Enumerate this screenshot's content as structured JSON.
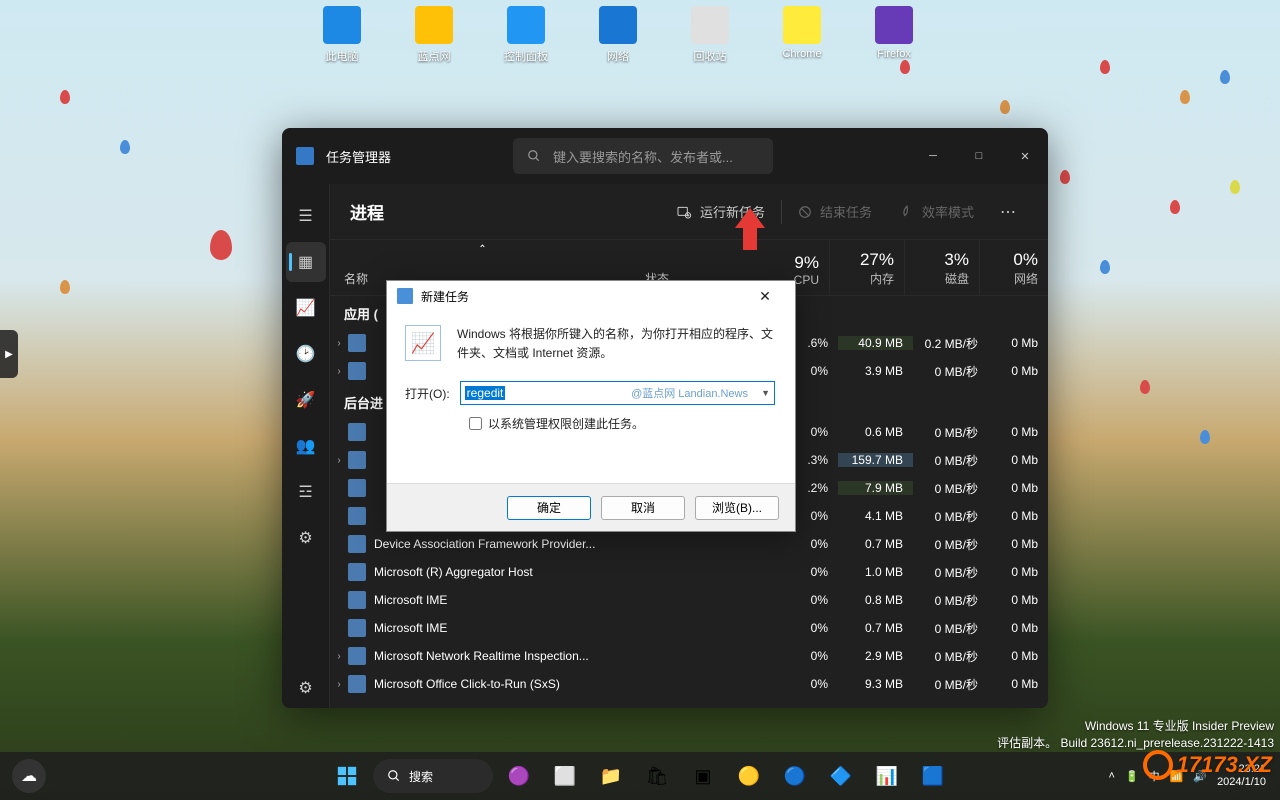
{
  "desktop": {
    "icons": [
      {
        "name": "此电脑",
        "color": "#1e88e5"
      },
      {
        "name": "蓝点网",
        "color": "#ffc107"
      },
      {
        "name": "控制面板",
        "color": "#2196f3"
      },
      {
        "name": "网络",
        "color": "#1976d2"
      },
      {
        "name": "回收站",
        "color": "#e0e0e0"
      },
      {
        "name": "Chrome",
        "color": "#ffeb3b"
      },
      {
        "name": "Firefox",
        "color": "#673ab7"
      }
    ]
  },
  "task_manager": {
    "title": "任务管理器",
    "search_placeholder": "键入要搜索的名称、发布者或...",
    "tab": "进程",
    "toolbar": {
      "run_new": "运行新任务",
      "end_task": "结束任务",
      "efficiency": "效率模式"
    },
    "columns": {
      "name": "名称",
      "status": "状态",
      "cpu": {
        "pct": "9%",
        "label": "CPU"
      },
      "mem": {
        "pct": "27%",
        "label": "内存"
      },
      "disk": {
        "pct": "3%",
        "label": "磁盘"
      },
      "net": {
        "pct": "0%",
        "label": "网络"
      }
    },
    "sections": {
      "apps": "应用 (",
      "background": "后台进"
    },
    "rows": [
      {
        "exp": "›",
        "name": "",
        "cpu": ".6%",
        "mem": "40.9 MB",
        "disk": "0.2 MB/秒",
        "net": "0 Mb",
        "h": 1
      },
      {
        "exp": "›",
        "name": "",
        "cpu": "0%",
        "mem": "3.9 MB",
        "disk": "0 MB/秒",
        "net": "0 Mb",
        "h": 0
      },
      {
        "exp": "",
        "name": "",
        "cpu": "0%",
        "mem": "0.6 MB",
        "disk": "0 MB/秒",
        "net": "0 Mb",
        "h": 0
      },
      {
        "exp": "›",
        "name": "",
        "cpu": ".3%",
        "mem": "159.7 MB",
        "disk": "0 MB/秒",
        "net": "0 Mb",
        "h": 2
      },
      {
        "exp": "",
        "name": "",
        "cpu": ".2%",
        "mem": "7.9 MB",
        "disk": "0 MB/秒",
        "net": "0 Mb",
        "h": 1
      },
      {
        "exp": "",
        "name": "",
        "cpu": "0%",
        "mem": "4.1 MB",
        "disk": "0 MB/秒",
        "net": "0 Mb",
        "h": 0
      },
      {
        "exp": "",
        "name": "Device Association Framework Provider...",
        "cpu": "0%",
        "mem": "0.7 MB",
        "disk": "0 MB/秒",
        "net": "0 Mb",
        "h": 0
      },
      {
        "exp": "",
        "name": "Microsoft (R) Aggregator Host",
        "cpu": "0%",
        "mem": "1.0 MB",
        "disk": "0 MB/秒",
        "net": "0 Mb",
        "h": 0
      },
      {
        "exp": "",
        "name": "Microsoft IME",
        "cpu": "0%",
        "mem": "0.8 MB",
        "disk": "0 MB/秒",
        "net": "0 Mb",
        "h": 0
      },
      {
        "exp": "",
        "name": "Microsoft IME",
        "cpu": "0%",
        "mem": "0.7 MB",
        "disk": "0 MB/秒",
        "net": "0 Mb",
        "h": 0
      },
      {
        "exp": "›",
        "name": "Microsoft Network Realtime Inspection...",
        "cpu": "0%",
        "mem": "2.9 MB",
        "disk": "0 MB/秒",
        "net": "0 Mb",
        "h": 0
      },
      {
        "exp": "›",
        "name": "Microsoft Office Click-to-Run (SxS)",
        "cpu": "0%",
        "mem": "9.3 MB",
        "disk": "0 MB/秒",
        "net": "0 Mb",
        "h": 0
      }
    ]
  },
  "dialog": {
    "title": "新建任务",
    "desc": "Windows 将根据你所键入的名称，为你打开相应的程序、文件夹、文档或 Internet 资源。",
    "open_label": "打开(O):",
    "value": "regedit",
    "watermark": "@蓝点网 Landian.News",
    "checkbox": "以系统管理权限创建此任务。",
    "ok": "确定",
    "cancel": "取消",
    "browse": "浏览(B)..."
  },
  "watermark": {
    "line1": "Windows 11 专业版 Insider Preview",
    "line2": "评估副本。 Build 23612.ni_prerelease.231222-1413"
  },
  "taskbar": {
    "search": "搜索",
    "time": "23:21",
    "date": "2024/1/10"
  },
  "site_wm": "17173.XZ"
}
